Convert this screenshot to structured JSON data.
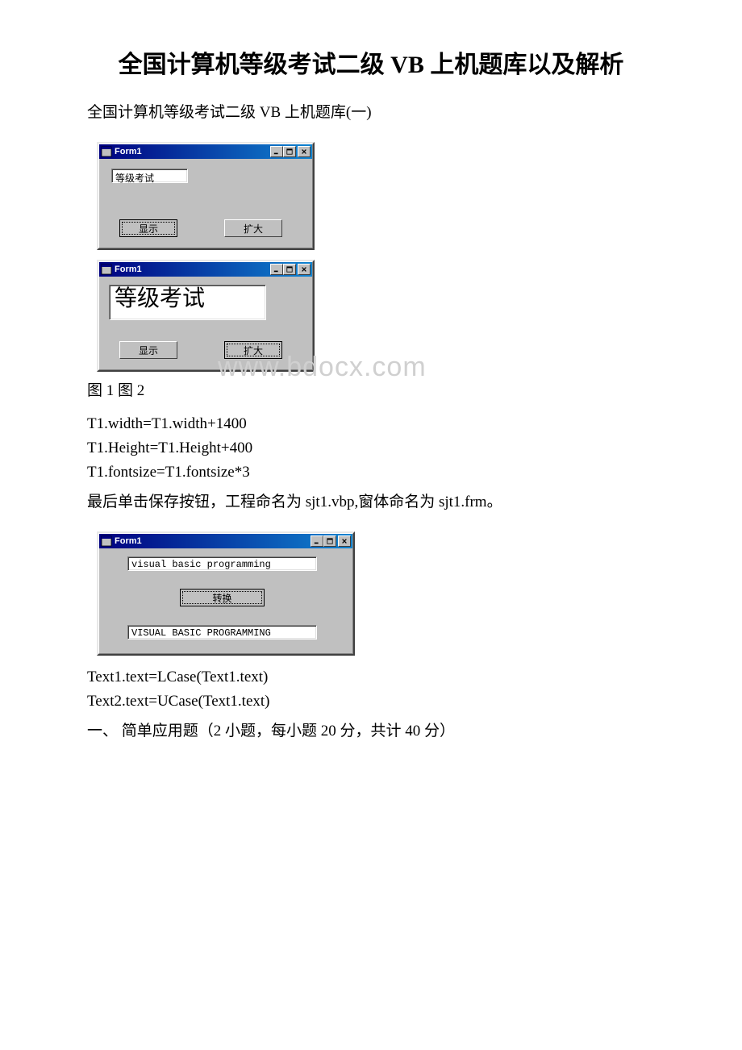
{
  "title": "全国计算机等级考试二级 VB 上机题库以及解析",
  "subtitle": "全国计算机等级考试二级 VB 上机题库(一)",
  "window1": {
    "title": "Form1",
    "textbox_value": "等级考试",
    "btn_display": "显示",
    "btn_enlarge": "扩大"
  },
  "window2": {
    "title": "Form1",
    "textbox_value": "等级考试",
    "btn_display": "显示",
    "btn_enlarge": "扩大"
  },
  "caption12": "图 1 图 2",
  "code1": [
    "T1.width=T1.width+1400",
    "T1.Height=T1.Height+400",
    "T1.fontsize=T1.fontsize*3"
  ],
  "instruction1": "最后单击保存按钮，工程命名为 sjt1.vbp,窗体命名为 sjt1.frm。",
  "window3": {
    "title": "Form1",
    "textbox1_value": "visual basic programming",
    "btn_convert": "转换",
    "textbox2_value": "VISUAL BASIC PROGRAMMING"
  },
  "code2": [
    "Text1.text=LCase(Text1.text)",
    "Text2.text=UCase(Text1.text)"
  ],
  "section_heading": "一、 简单应用题（2 小题，每小题 20 分，共计 40 分）",
  "watermark": "www.bdocx.com"
}
